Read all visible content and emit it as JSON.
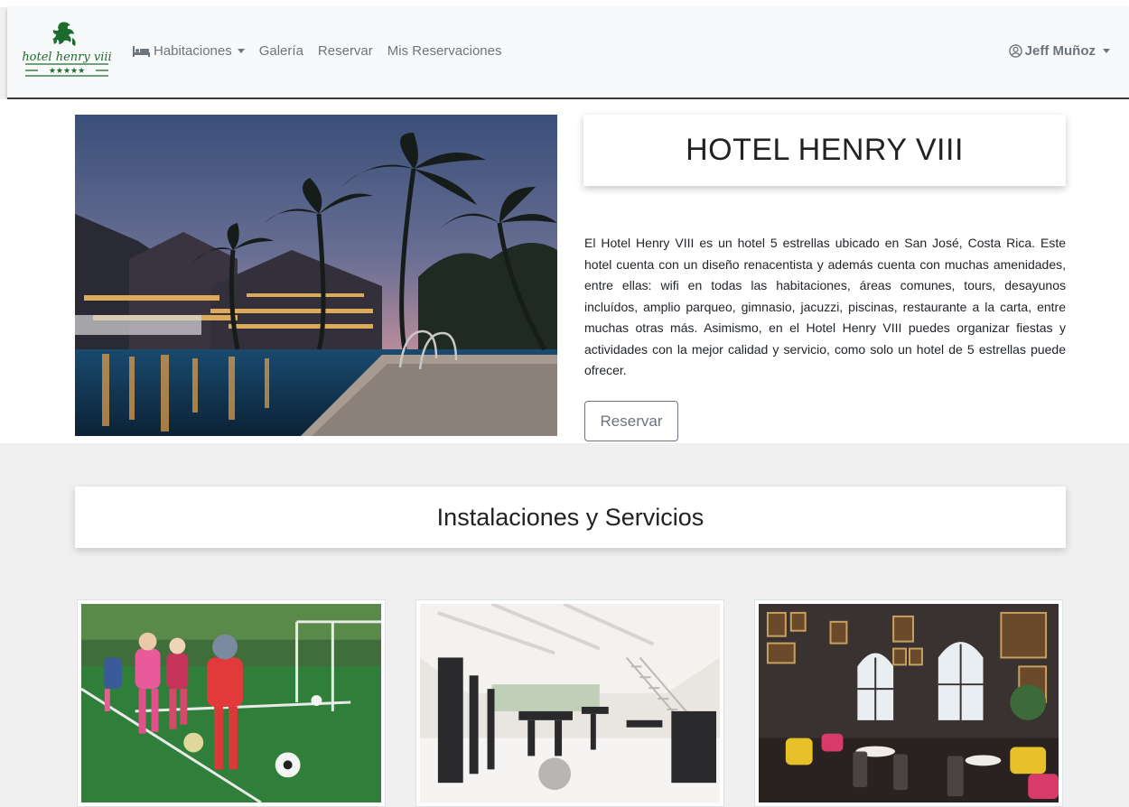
{
  "navbar": {
    "logo_text": "hotel henry viii",
    "items": [
      {
        "label": "Habitaciones",
        "has_dropdown": true,
        "icon": "bed-icon"
      },
      {
        "label": "Galería",
        "has_dropdown": false
      },
      {
        "label": "Reservar",
        "has_dropdown": false
      },
      {
        "label": "Mis Reservaciones",
        "has_dropdown": false
      }
    ],
    "user": {
      "name": "Jeff Muñoz",
      "icon": "user-circle-icon",
      "has_dropdown": true
    }
  },
  "hero": {
    "title": "HOTEL HENRY VIII",
    "description": "El Hotel Henry VIII es un hotel 5 estrellas ubicado en San José, Costa Rica. Este hotel cuenta con un diseño renacentista y además cuenta con muchas amenidades, entre ellas: wifi en todas las habitaciones, áreas comunes, tours, desayunos incluídos, amplio parqueo, gimnasio, jacuzzi, piscinas, restaurante a la carta, entre muchas otras más. Asimismo, en el Hotel Henry VIII puedes organizar fiestas y actividades con la mejor calidad y servicio, como solo un hotel de 5 estrellas puede ofrecer.",
    "button_label": "Reservar"
  },
  "services": {
    "title": "Instalaciones y Servicios"
  },
  "colors": {
    "accent_green": "#1e6b2e",
    "muted": "#6c757d"
  }
}
